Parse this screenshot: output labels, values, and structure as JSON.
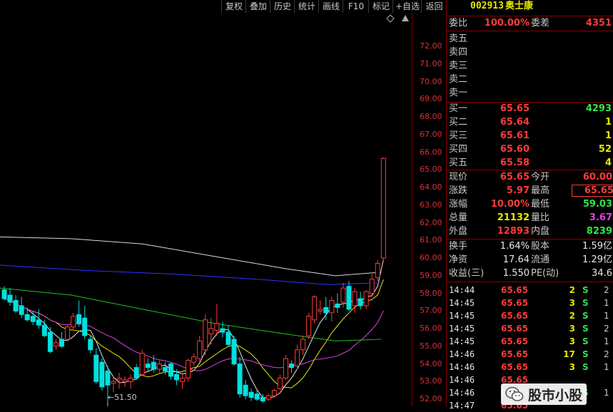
{
  "toolbar": {
    "buttons": [
      "复权",
      "叠加",
      "历史",
      "统计",
      "画线",
      "F10",
      "标记",
      "+自选",
      "返回"
    ]
  },
  "chart_data": {
    "type": "candlestick",
    "y_ticks": [
      "72.00",
      "71.00",
      "70.00",
      "69.00",
      "68.00",
      "67.00",
      "66.00",
      "65.00",
      "64.00",
      "63.00",
      "62.00",
      "61.00",
      "60.00",
      "59.00",
      "58.00",
      "57.00",
      "56.00",
      "55.00",
      "54.00",
      "53.00",
      "52.00"
    ],
    "ylim": [
      51.6,
      73.9
    ],
    "low_annotation": "←51.50",
    "candles": [
      [
        58.2,
        58.4,
        57.6,
        57.7
      ],
      [
        57.9,
        58.3,
        57.3,
        57.5
      ],
      [
        57.6,
        57.9,
        56.9,
        57.0
      ],
      [
        57.3,
        57.8,
        56.6,
        56.8
      ],
      [
        56.8,
        57.2,
        56.4,
        56.5
      ],
      [
        56.7,
        57.0,
        56.2,
        56.4
      ],
      [
        56.5,
        57.1,
        56.0,
        56.2
      ],
      [
        56.2,
        56.5,
        55.5,
        55.6
      ],
      [
        55.8,
        56.1,
        54.6,
        54.7
      ],
      [
        55.0,
        55.4,
        54.8,
        55.2
      ],
      [
        55.4,
        55.8,
        54.9,
        55.0
      ],
      [
        55.4,
        56.2,
        55.3,
        56.1
      ],
      [
        56.1,
        56.9,
        55.9,
        56.7
      ],
      [
        56.8,
        57.6,
        56.1,
        56.3
      ],
      [
        56.6,
        57.3,
        55.4,
        55.6
      ],
      [
        55.4,
        55.6,
        54.6,
        54.8
      ],
      [
        54.5,
        54.9,
        52.9,
        53.0
      ],
      [
        54.1,
        54.3,
        52.5,
        52.7
      ],
      [
        53.6,
        53.9,
        51.8,
        52.8
      ],
      [
        52.9,
        53.3,
        52.4,
        53.0
      ],
      [
        53.1,
        53.5,
        52.6,
        53.2
      ],
      [
        53.0,
        53.3,
        52.7,
        53.1
      ],
      [
        53.0,
        53.4,
        52.6,
        53.2
      ],
      [
        53.8,
        54.0,
        53.1,
        53.2
      ],
      [
        53.4,
        54.8,
        53.3,
        54.6
      ],
      [
        54.0,
        54.3,
        53.6,
        53.8
      ],
      [
        54.1,
        54.5,
        53.5,
        53.7
      ],
      [
        53.7,
        54.2,
        53.5,
        54.0
      ],
      [
        53.8,
        54.1,
        53.4,
        53.6
      ],
      [
        54.0,
        54.1,
        53.1,
        53.3
      ],
      [
        53.4,
        53.7,
        52.8,
        53.1
      ],
      [
        53.0,
        53.4,
        52.6,
        53.2
      ],
      [
        53.2,
        54.3,
        53.0,
        54.2
      ],
      [
        54.1,
        54.6,
        53.9,
        54.4
      ],
      [
        54.3,
        55.6,
        54.1,
        55.3
      ],
      [
        54.8,
        56.8,
        54.5,
        56.5
      ],
      [
        55.7,
        56.6,
        55.1,
        56.0
      ],
      [
        55.9,
        57.4,
        55.6,
        56.3
      ],
      [
        56.0,
        56.4,
        55.5,
        55.8
      ],
      [
        55.8,
        56.2,
        55.0,
        55.1
      ],
      [
        55.4,
        55.6,
        53.9,
        54.0
      ],
      [
        54.0,
        54.4,
        52.1,
        52.3
      ],
      [
        52.8,
        53.1,
        52.0,
        52.2
      ],
      [
        52.4,
        52.6,
        51.9,
        52.1
      ],
      [
        52.3,
        52.5,
        51.9,
        52.0
      ],
      [
        52.1,
        52.3,
        51.8,
        51.9
      ],
      [
        52.0,
        52.3,
        51.9,
        52.2
      ],
      [
        52.2,
        52.6,
        52.1,
        52.5
      ],
      [
        52.6,
        53.4,
        52.5,
        53.2
      ],
      [
        53.2,
        54.5,
        53.1,
        54.3
      ],
      [
        54.0,
        54.2,
        53.5,
        53.8
      ],
      [
        53.9,
        55.1,
        53.7,
        54.8
      ],
      [
        54.8,
        55.6,
        54.5,
        55.4
      ],
      [
        55.6,
        56.9,
        55.4,
        56.7
      ],
      [
        56.5,
        57.9,
        56.3,
        57.8
      ],
      [
        57.0,
        57.6,
        56.8,
        57.1
      ],
      [
        57.2,
        57.8,
        56.5,
        56.9
      ],
      [
        56.9,
        57.8,
        56.4,
        57.6
      ],
      [
        57.4,
        58.0,
        56.9,
        57.2
      ],
      [
        57.5,
        58.6,
        57.2,
        58.3
      ],
      [
        58.4,
        58.7,
        57.0,
        57.1
      ],
      [
        57.3,
        58.3,
        56.9,
        58.1
      ],
      [
        57.7,
        58.1,
        57.1,
        57.3
      ],
      [
        57.3,
        58.2,
        57.1,
        58.1
      ],
      [
        58.0,
        59.1,
        57.8,
        58.8
      ],
      [
        58.9,
        59.9,
        58.7,
        59.7
      ],
      [
        60.0,
        65.7,
        59.8,
        65.65
      ]
    ]
  },
  "quote": {
    "code": "002913",
    "name": "奥士康",
    "weibi_label": "委比",
    "weibi_value": "100.00%",
    "weicha_label": "委差",
    "weicha_value": "4351",
    "sell": [
      {
        "label": "卖五",
        "price": "",
        "vol": ""
      },
      {
        "label": "卖四",
        "price": "",
        "vol": ""
      },
      {
        "label": "卖三",
        "price": "",
        "vol": ""
      },
      {
        "label": "卖二",
        "price": "",
        "vol": ""
      },
      {
        "label": "卖一",
        "price": "",
        "vol": ""
      }
    ],
    "buy": [
      {
        "label": "买一",
        "price": "65.65",
        "vol": "4293"
      },
      {
        "label": "买二",
        "price": "65.64",
        "vol": "1"
      },
      {
        "label": "买三",
        "price": "65.61",
        "vol": "1"
      },
      {
        "label": "买四",
        "price": "65.60",
        "vol": "52"
      },
      {
        "label": "买五",
        "price": "65.58",
        "vol": "4"
      }
    ],
    "stats": [
      {
        "l1": "现价",
        "v1": "65.65",
        "l2": "今开",
        "v2": "60.00"
      },
      {
        "l1": "涨跌",
        "v1": "5.97",
        "l2": "最高",
        "v2": "65.65"
      },
      {
        "l1": "涨幅",
        "v1": "10.00%",
        "l2": "最低",
        "v2": "59.03"
      },
      {
        "l1": "总量",
        "v1": "21132",
        "l2": "量比",
        "v2": "3.67"
      },
      {
        "l1": "外盘",
        "v1": "12893",
        "l2": "内盘",
        "v2": "8239"
      }
    ],
    "fund": [
      {
        "l1": "换手",
        "v1": "1.64%",
        "l2": "股本",
        "v2": "1.59亿"
      },
      {
        "l1": "净资",
        "v1": "17.64",
        "l2": "流通",
        "v2": "1.29亿"
      },
      {
        "l1": "收益(三)",
        "v1": "1.550",
        "l2": "PE(动)",
        "v2": "34.6"
      }
    ],
    "ticks": [
      {
        "t": "14:44",
        "p": "65.65",
        "v": "2",
        "bs": "S",
        "n": "2"
      },
      {
        "t": "14:45",
        "p": "65.65",
        "v": "3",
        "bs": "S",
        "n": "1"
      },
      {
        "t": "14:45",
        "p": "65.65",
        "v": "2",
        "bs": "S",
        "n": "1"
      },
      {
        "t": "14:45",
        "p": "65.65",
        "v": "3",
        "bs": "S",
        "n": "2"
      },
      {
        "t": "14:45",
        "p": "65.65",
        "v": "3",
        "bs": "S",
        "n": "1"
      },
      {
        "t": "14:46",
        "p": "65.65",
        "v": "17",
        "bs": "S",
        "n": "2"
      },
      {
        "t": "14:46",
        "p": "65.65",
        "v": "3",
        "bs": "S",
        "n": "1"
      },
      {
        "t": "14:46",
        "p": "65.65",
        "v": "",
        "bs": "",
        "n": ""
      },
      {
        "t": "14:46",
        "p": "65.65",
        "v": "10",
        "bs": "S",
        "n": "1"
      },
      {
        "t": "14:47",
        "p": "65.65",
        "v": "",
        "bs": "",
        "n": ""
      }
    ]
  },
  "watermark": {
    "text": "股市小股"
  }
}
